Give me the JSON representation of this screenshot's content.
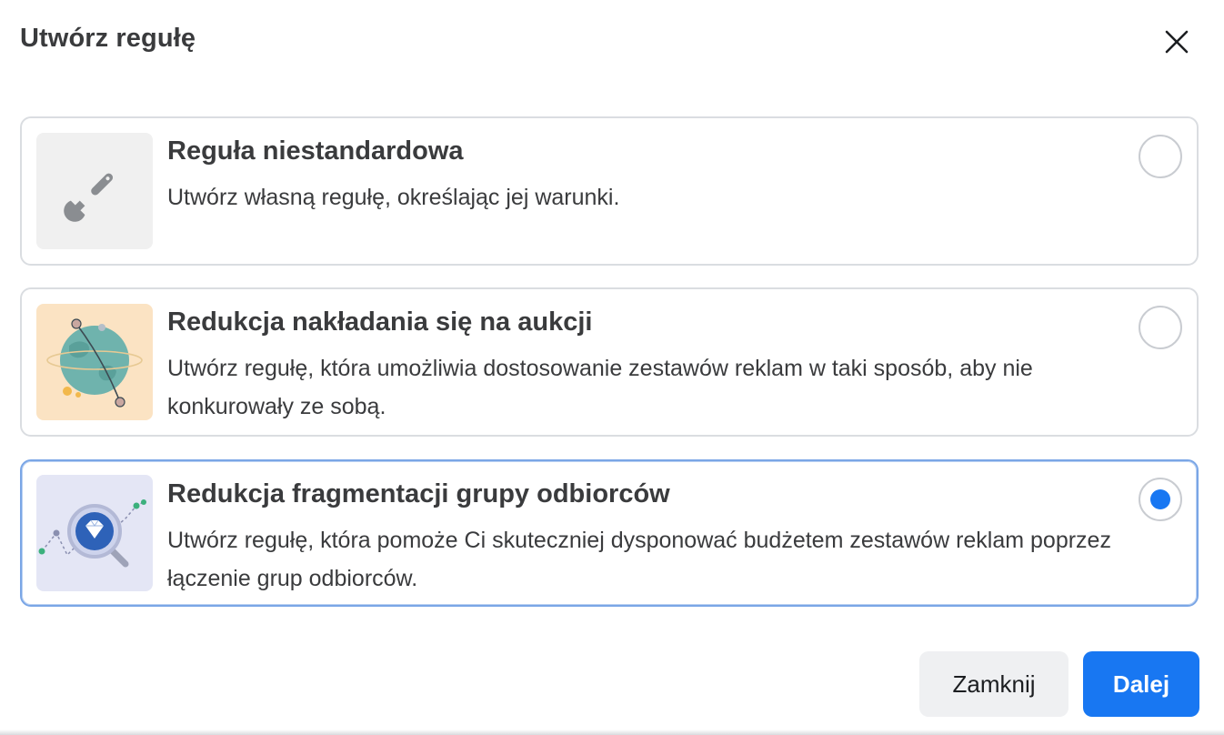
{
  "dialog": {
    "title": "Utwórz regułę",
    "close_icon": "close-icon"
  },
  "options": [
    {
      "title": "Reguła niestandardowa",
      "description": "Utwórz własną regułę, określając jej warunki.",
      "icon": "wrench-icon",
      "selected": false
    },
    {
      "title": "Redukcja nakładania się na aukcji",
      "description": "Utwórz regułę, która umożliwia dostosowanie zestawów reklam w taki sposób, aby nie konkurowały ze sobą.",
      "icon": "globe-illustration",
      "selected": false
    },
    {
      "title": "Redukcja fragmentacji grupy odbiorców",
      "description": "Utwórz regułę, która pomoże Ci skuteczniej dysponować budżetem zestawów reklam poprzez łączenie grup odbiorców.",
      "icon": "diamond-magnifier-illustration",
      "selected": true
    }
  ],
  "footer": {
    "close_label": "Zamknij",
    "next_label": "Dalej"
  },
  "colors": {
    "primary": "#1877f2",
    "text": "#3a3b3d",
    "border": "#dadde1",
    "selected_border": "#7aa6e6"
  }
}
